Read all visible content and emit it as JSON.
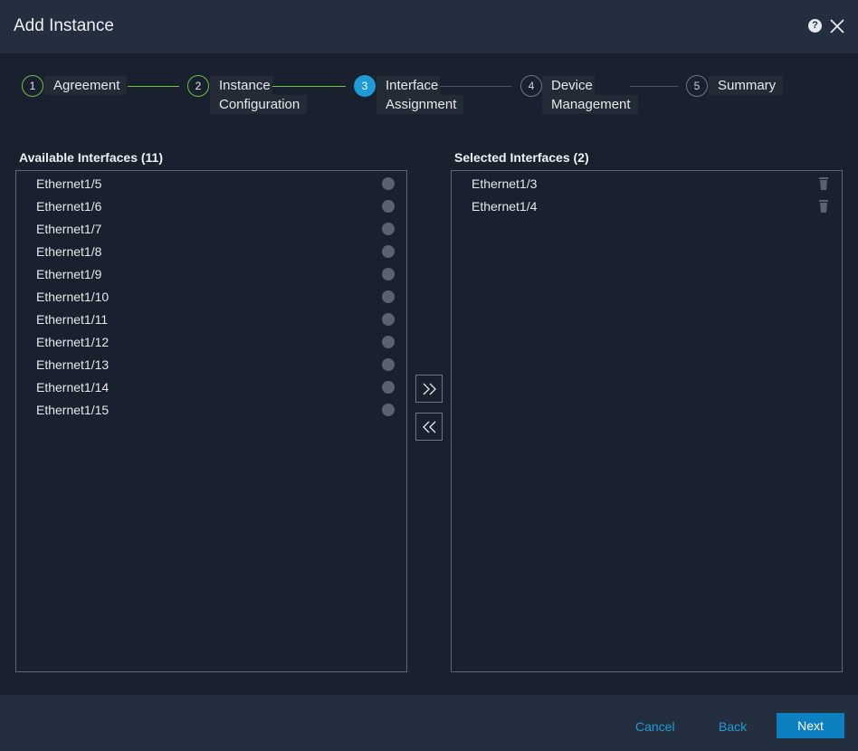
{
  "header": {
    "title": "Add Instance",
    "help_icon": "help-icon",
    "help_glyph": "?",
    "close_icon": "close-icon"
  },
  "wizard": {
    "steps": [
      {
        "number": "1",
        "line1": "Agreement",
        "line2": "",
        "state": "done"
      },
      {
        "number": "2",
        "line1": "Instance",
        "line2": "Configuration",
        "state": "done"
      },
      {
        "number": "3",
        "line1": "Interface",
        "line2": "Assignment",
        "state": "active"
      },
      {
        "number": "4",
        "line1": "Device",
        "line2": "Management",
        "state": "pending"
      },
      {
        "number": "5",
        "line1": "Summary",
        "line2": "",
        "state": "pending"
      }
    ]
  },
  "available": {
    "title": "Available Interfaces (11)",
    "items": [
      "Ethernet1/5",
      "Ethernet1/6",
      "Ethernet1/7",
      "Ethernet1/8",
      "Ethernet1/9",
      "Ethernet1/10",
      "Ethernet1/11",
      "Ethernet1/12",
      "Ethernet1/13",
      "Ethernet1/14",
      "Ethernet1/15"
    ]
  },
  "selected": {
    "title": "Selected Interfaces (2)",
    "items": [
      "Ethernet1/3",
      "Ethernet1/4"
    ]
  },
  "transfer": {
    "add_all_icon": "double-chevron-right-icon",
    "remove_all_icon": "double-chevron-left-icon"
  },
  "footer": {
    "cancel": "Cancel",
    "back": "Back",
    "next": "Next"
  },
  "colors": {
    "accent": "#1f9bd7",
    "done": "#6cc04a",
    "primary_button": "#0d80c2"
  }
}
